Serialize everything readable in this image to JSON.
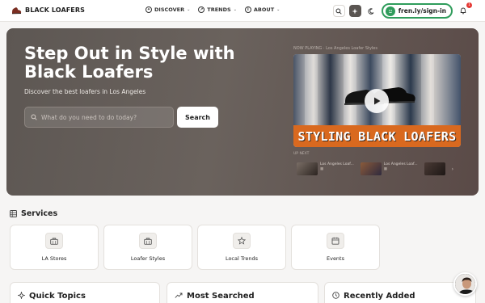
{
  "brand": {
    "name": "BLACK LOAFERS"
  },
  "nav": [
    {
      "label": "DISCOVER",
      "icon": "compass-icon"
    },
    {
      "label": "TRENDS",
      "icon": "trend-icon"
    },
    {
      "label": "ABOUT",
      "icon": "info-icon"
    }
  ],
  "header": {
    "signin_label": "fren.ly/sign-in",
    "notification_count": "1"
  },
  "hero": {
    "title": "Step Out in Style with Black Loafers",
    "subtitle": "Discover the best loafers in Los Angeles",
    "search_placeholder": "What do you need to do today?",
    "search_button": "Search",
    "now_playing": "NOW PLAYING · Los Angeles Loafer Styles",
    "video_banner": "STYLING BLACK LOAFERS",
    "up_next": "UP NEXT",
    "playlist": [
      {
        "title": "Los Angeles Loaf...",
        "meta": "■"
      },
      {
        "title": "Los Angeles Loaf...",
        "meta": "■"
      }
    ]
  },
  "services": {
    "title": "Services",
    "items": [
      {
        "label": "LA Stores",
        "icon": "briefcase-icon"
      },
      {
        "label": "Loafer Styles",
        "icon": "briefcase-icon"
      },
      {
        "label": "Local Trends",
        "icon": "star-icon"
      },
      {
        "label": "Events",
        "icon": "calendar-icon"
      }
    ]
  },
  "panels": {
    "quick_topics": "Quick Topics",
    "most_searched": "Most Searched",
    "recently_added": "Recently Added"
  },
  "colors": {
    "accent_green": "#2f9c5b",
    "hero_bg": "#5d5753",
    "banner_orange": "#d9691f",
    "badge_red": "#e53935"
  }
}
